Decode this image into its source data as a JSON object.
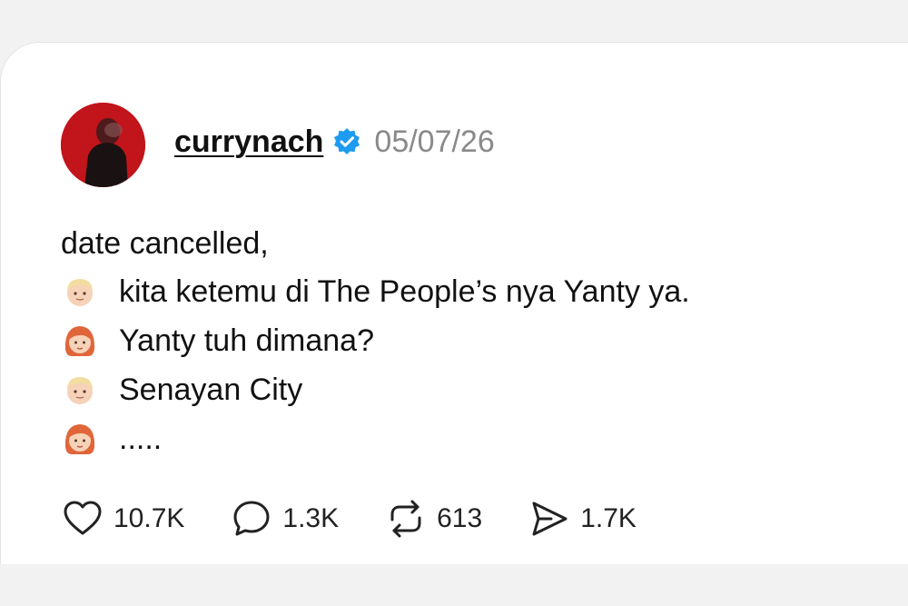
{
  "post": {
    "username": "currynach",
    "verified": true,
    "date": "05/07/26",
    "lines": [
      "date cancelled,",
      "kita ketemu di The People’s nya Yanty ya.",
      "Yanty tuh dimana?",
      "Senayan City",
      "....."
    ],
    "line_emoji": [
      "",
      "blonde-person-emoji",
      "red-haired-woman-emoji",
      "blonde-person-emoji",
      "red-haired-woman-emoji"
    ],
    "stats": {
      "likes": "10.7K",
      "comments": "1.3K",
      "reposts": "613",
      "shares": "1.7K"
    }
  },
  "colors": {
    "verified": "#1d9bf0",
    "avatar_bg": "#c2141b",
    "date": "#8a8a8a"
  }
}
